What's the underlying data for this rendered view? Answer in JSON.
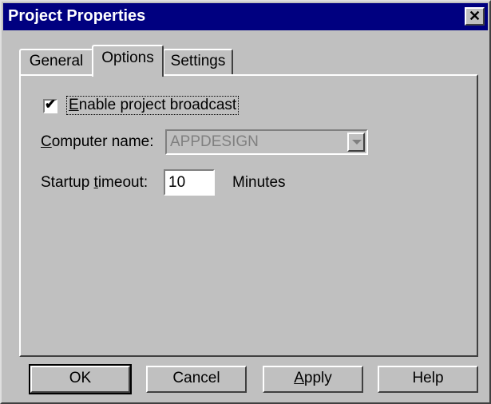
{
  "window": {
    "title": "Project Properties",
    "close_glyph": "✕"
  },
  "tabs": [
    {
      "label": "General",
      "selected": false
    },
    {
      "label": "Options",
      "selected": true
    },
    {
      "label": "Settings",
      "selected": false
    }
  ],
  "options": {
    "broadcast": {
      "checked": true,
      "check_glyph": "✔",
      "mnemonic": "E",
      "label_rest": "nable project broadcast"
    },
    "computer_name": {
      "mnemonic": "C",
      "label_rest": "omputer name:",
      "value": "APPDESIGN",
      "disabled": true
    },
    "startup_timeout": {
      "label_pre": "Startup ",
      "mnemonic": "t",
      "label_rest": "imeout:",
      "value": "10",
      "unit": "Minutes"
    }
  },
  "buttons": {
    "ok": "OK",
    "cancel": "Cancel",
    "apply_mnemonic": "A",
    "apply_rest": "pply",
    "help": "Help"
  },
  "colors": {
    "titlebar": "#000080",
    "face": "#c0c0c0",
    "disabled_text": "#808080"
  }
}
